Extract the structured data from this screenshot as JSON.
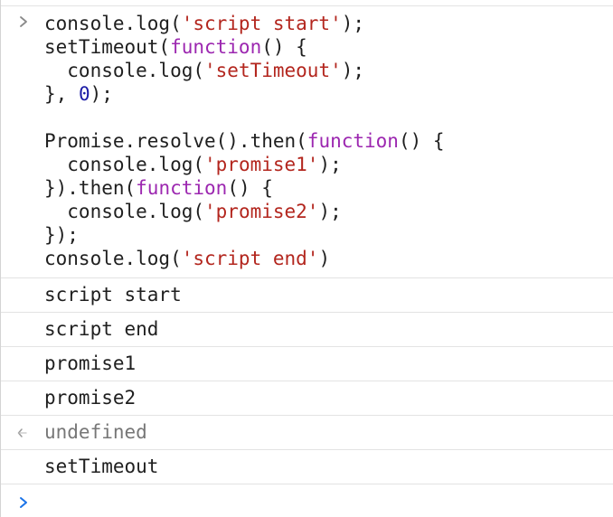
{
  "colors": {
    "string": "#b3261e",
    "keyword": "#9c27b0",
    "number": "#1a1aa6",
    "text": "#1f1f1f",
    "muted": "#777777",
    "prompt_accent": "#1a73e8"
  },
  "icons": {
    "input_prompt": "chevron-right-icon",
    "result_marker": "return-arrow-icon",
    "active_prompt": "chevron-right-icon"
  },
  "input": {
    "lines": [
      [
        [
          "plain",
          "console.log("
        ],
        [
          "str",
          "'script start'"
        ],
        [
          "plain",
          ");"
        ]
      ],
      [
        [
          "plain",
          "setTimeout("
        ],
        [
          "kw",
          "function"
        ],
        [
          "plain",
          "() {"
        ]
      ],
      [
        [
          "plain",
          "  console.log("
        ],
        [
          "str",
          "'setTimeout'"
        ],
        [
          "plain",
          ");"
        ]
      ],
      [
        [
          "plain",
          "}, "
        ],
        [
          "num",
          "0"
        ],
        [
          "plain",
          ");"
        ]
      ],
      [],
      [
        [
          "plain",
          "Promise.resolve().then("
        ],
        [
          "kw",
          "function"
        ],
        [
          "plain",
          "() {"
        ]
      ],
      [
        [
          "plain",
          "  console.log("
        ],
        [
          "str",
          "'promise1'"
        ],
        [
          "plain",
          ");"
        ]
      ],
      [
        [
          "plain",
          "}).then("
        ],
        [
          "kw",
          "function"
        ],
        [
          "plain",
          "() {"
        ]
      ],
      [
        [
          "plain",
          "  console.log("
        ],
        [
          "str",
          "'promise2'"
        ],
        [
          "plain",
          ");"
        ]
      ],
      [
        [
          "plain",
          "});"
        ]
      ],
      [
        [
          "plain",
          "console.log("
        ],
        [
          "str",
          "'script end'"
        ],
        [
          "plain",
          ")"
        ]
      ]
    ]
  },
  "output": [
    {
      "text": "script start",
      "kind": "log"
    },
    {
      "text": "script end",
      "kind": "log"
    },
    {
      "text": "promise1",
      "kind": "log"
    },
    {
      "text": "promise2",
      "kind": "log"
    },
    {
      "text": "undefined",
      "kind": "result"
    },
    {
      "text": "setTimeout",
      "kind": "log"
    }
  ],
  "prompt": {
    "value": ""
  }
}
